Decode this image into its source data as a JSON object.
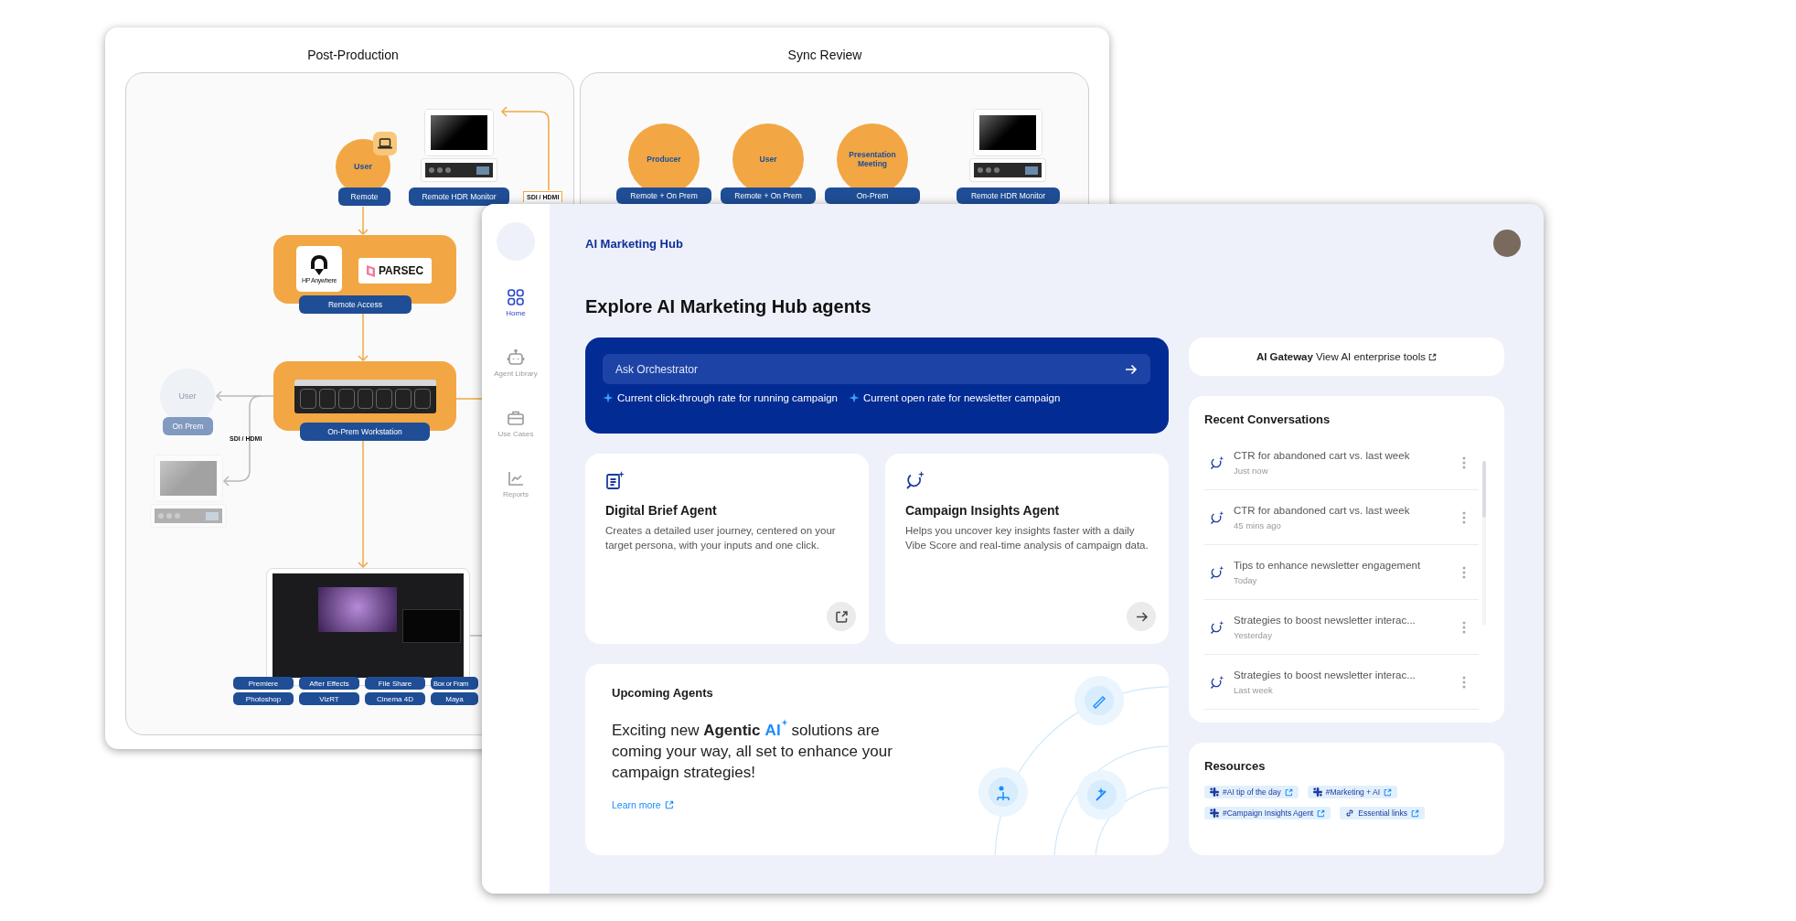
{
  "diagram": {
    "post_production": {
      "title": "Post-Production",
      "user": {
        "name": "User",
        "label": "Remote"
      },
      "monitor_label": "Remote HDR Monitor",
      "link_label": "SDI / HDMI",
      "remote_access": {
        "label": "Remote Access",
        "hp_logo": "HP Anywhere",
        "parsec_logo": "PARSEC"
      },
      "workstation_label": "On-Prem Workstation",
      "onprem_user": {
        "name": "User",
        "label": "On Prem",
        "disabled": true
      },
      "onprem_link_label": "SDI / HDMI",
      "apps": [
        [
          "Premiere",
          "Photoshop"
        ],
        [
          "After Effects",
          "VizRT"
        ],
        [
          "File Share",
          "Cinema 4D"
        ],
        [
          "Box or Fram",
          "Maya"
        ]
      ]
    },
    "sync_review": {
      "title": "Sync Review",
      "participants": [
        {
          "name": "Producer",
          "label": "Remote + On Prem"
        },
        {
          "name": "User",
          "label": "Remote + On Prem"
        },
        {
          "name": "Presentation Meeting",
          "label": "On-Prem"
        }
      ],
      "monitor_label": "Remote HDR Monitor"
    }
  },
  "app": {
    "brand": "AI Marketing Hub",
    "nav": [
      {
        "kind": "home",
        "label": "Home",
        "selected": true
      },
      {
        "kind": "robot",
        "label": "Agent Library",
        "selected": false
      },
      {
        "kind": "briefcase",
        "label": "Use Cases",
        "selected": false
      },
      {
        "kind": "chart",
        "label": "Reports",
        "selected": false
      }
    ],
    "heading": "Explore AI Marketing Hub agents",
    "orchestrator": {
      "placeholder": "Ask Orchestrator",
      "suggestions": [
        "Current click-through rate for running campaign",
        "Current open rate for newsletter campaign"
      ]
    },
    "agents": [
      {
        "kind": "brief",
        "title": "Digital Brief Agent",
        "description": "Creates a detailed user journey, centered on your target persona, with your inputs and one click."
      },
      {
        "kind": "insights",
        "title": "Campaign Insights Agent",
        "description": "Helps you uncover key insights faster with a daily Vibe Score and real-time analysis of campaign data."
      }
    ],
    "upcoming": {
      "title": "Upcoming Agents",
      "message": [
        {
          "kind": "plain",
          "text": "Exciting new "
        },
        {
          "kind": "bold",
          "text": "Agentic"
        },
        {
          "kind": "accent",
          "text": "AI"
        },
        {
          "kind": "plain",
          "text": " solutions are coming your way, all set to enhance your campaign strategies!"
        }
      ],
      "link": "Learn more"
    },
    "gateway": {
      "title": "AI Gateway",
      "link": "View AI enterprise tools"
    },
    "recent": {
      "title": "Recent Conversations",
      "items": [
        {
          "title": "CTR for abandoned cart vs. last week",
          "time": "Just now"
        },
        {
          "title": "CTR for abandoned cart vs. last week",
          "time": "45 mins ago"
        },
        {
          "title": "Tips to enhance newsletter engagement",
          "time": "Today"
        },
        {
          "title": "Strategies to boost newsletter interac...",
          "time": "Yesterday"
        },
        {
          "title": "Strategies to boost newsletter interac...",
          "time": "Last week"
        }
      ]
    },
    "resources": {
      "title": "Resources",
      "links": [
        {
          "kind": "slack",
          "label": "#AI tip of the day"
        },
        {
          "kind": "slack",
          "label": "#Marketing + AI"
        },
        {
          "kind": "slack",
          "label": "#Campaign Insights Agent"
        },
        {
          "kind": "link",
          "label": "Essential links"
        }
      ]
    }
  }
}
